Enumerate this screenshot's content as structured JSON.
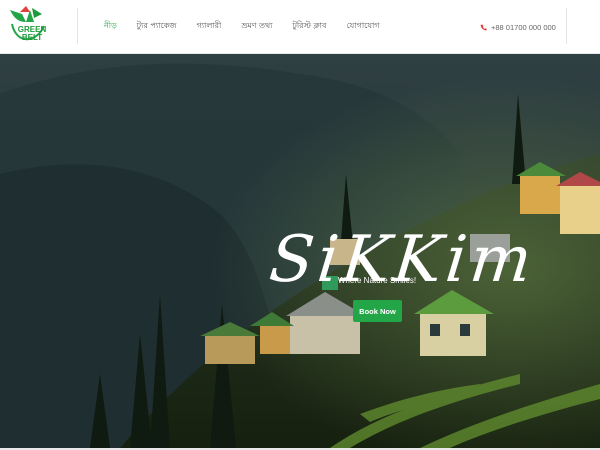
{
  "logo": {
    "line1": "GREEN",
    "line2": "BELT",
    "icon": "green-belt-logo-icon"
  },
  "nav": {
    "items": [
      {
        "label": "নীড়"
      },
      {
        "label": "ট্যুর প্যাকেজ"
      },
      {
        "label": "গ্যালারী"
      },
      {
        "label": "ভ্রমণ তথ্য"
      },
      {
        "label": "টুরিস্ট ক্লাব"
      },
      {
        "label": "যোগাযোগ"
      }
    ],
    "active_index": 0
  },
  "contact": {
    "phone": "+88 01700 000 000",
    "icon": "phone-icon"
  },
  "hero": {
    "title": "SiKKim",
    "subtitle": "Where Nature Smiles!",
    "button_label": "Book Now"
  },
  "colors": {
    "brand_green": "#23a648",
    "nav_active": "#27a847",
    "phone_icon": "#e0413b"
  }
}
